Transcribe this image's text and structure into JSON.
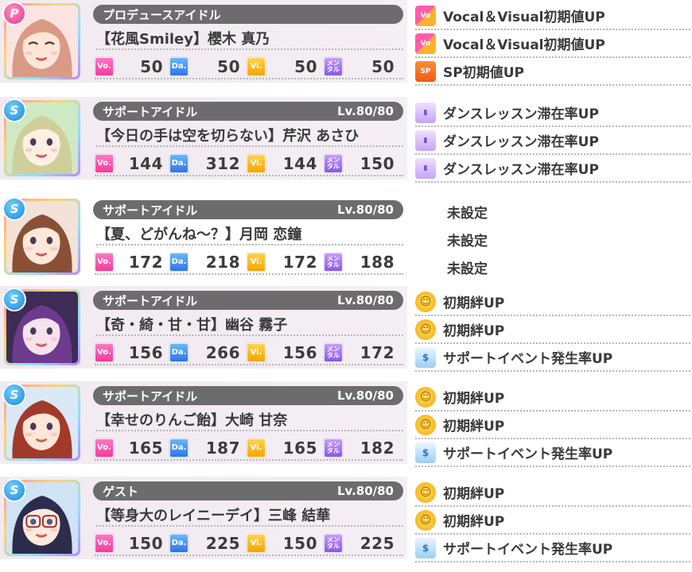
{
  "rows": [
    {
      "role_badge": "P",
      "type_label": "プロデュースアイドル",
      "level": "",
      "card_name": "【花風Smiley】櫻木 真乃",
      "stats": {
        "vo": "50",
        "da": "50",
        "vi": "50",
        "mental": "50"
      },
      "skills": [
        "Vocal＆Visual初期値UP",
        "Vocal＆Visual初期値UP",
        "SP初期値UP"
      ],
      "skill_icons": [
        "vocal-visual-icon",
        "vocal-visual-icon",
        "sp-icon"
      ]
    },
    {
      "role_badge": "S",
      "type_label": "サポートアイドル",
      "level": "Lv.80/80",
      "card_name": "【今日の手は空を切らない】芹沢 あさひ",
      "stats": {
        "vo": "144",
        "da": "312",
        "vi": "144",
        "mental": "150"
      },
      "skills": [
        "ダンスレッスン滞在率UP",
        "ダンスレッスン滞在率UP",
        "ダンスレッスン滞在率UP"
      ],
      "skill_icons": [
        "dance-lesson-icon",
        "dance-lesson-icon",
        "dance-lesson-icon"
      ]
    },
    {
      "role_badge": "S",
      "type_label": "サポートアイドル",
      "level": "Lv.80/80",
      "card_name": "【夏、どがんね～？】月岡 恋鐘",
      "stats": {
        "vo": "172",
        "da": "218",
        "vi": "172",
        "mental": "188"
      },
      "skills": [
        "未設定",
        "未設定",
        "未設定"
      ],
      "skill_icons": [
        "",
        "",
        ""
      ]
    },
    {
      "role_badge": "S",
      "type_label": "サポートアイドル",
      "level": "Lv.80/80",
      "card_name": "【奇・綺・甘・甘】幽谷 霧子",
      "stats": {
        "vo": "156",
        "da": "266",
        "vi": "156",
        "mental": "172"
      },
      "skills": [
        "初期絆UP",
        "初期絆UP",
        "サポートイベント発生率UP"
      ],
      "skill_icons": [
        "bond-icon",
        "bond-icon",
        "support-event-icon"
      ]
    },
    {
      "role_badge": "S",
      "type_label": "サポートアイドル",
      "level": "Lv.80/80",
      "card_name": "【幸せのりんご飴】大崎 甘奈",
      "stats": {
        "vo": "165",
        "da": "187",
        "vi": "165",
        "mental": "182"
      },
      "skills": [
        "初期絆UP",
        "初期絆UP",
        "サポートイベント発生率UP"
      ],
      "skill_icons": [
        "bond-icon",
        "bond-icon",
        "support-event-icon"
      ]
    },
    {
      "role_badge": "S",
      "type_label": "ゲスト",
      "level": "Lv.80/80",
      "card_name": "【等身大のレイニーデイ】三峰 結華",
      "stats": {
        "vo": "150",
        "da": "225",
        "vi": "150",
        "mental": "225"
      },
      "skills": [
        "初期絆UP",
        "初期絆UP",
        "サポートイベント発生率UP"
      ],
      "skill_icons": [
        "bond-icon",
        "bond-icon",
        "support-event-icon"
      ]
    }
  ],
  "stat_icons": {
    "vo": "Vo.",
    "da": "Da.",
    "vi": "Vi.",
    "mental": "メンタル"
  },
  "colors": {
    "vo": "#f43b9c",
    "da": "#2f74e6",
    "vi": "#f5a500",
    "mental": "#8858e6",
    "pill": "#6c6c6c",
    "row_bg": "#f1eaf1"
  }
}
